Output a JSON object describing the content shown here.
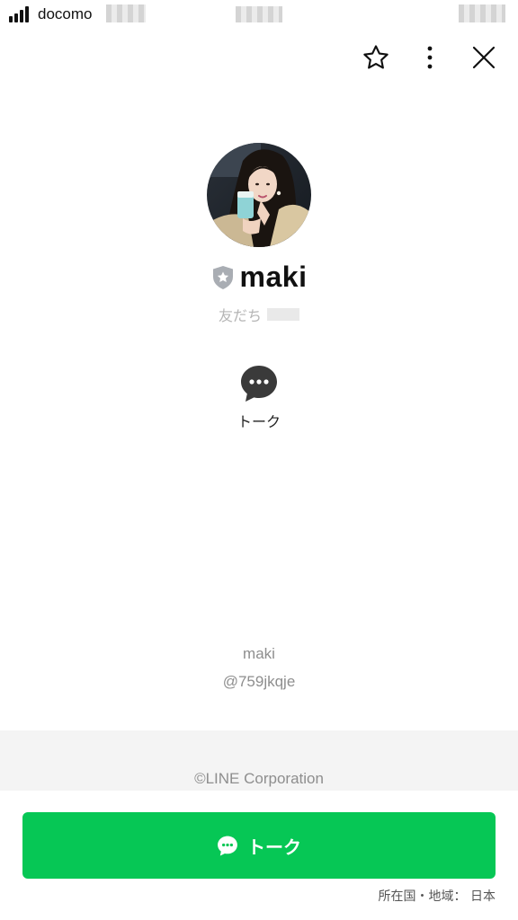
{
  "status_bar": {
    "carrier": "docomo"
  },
  "top_actions": {
    "favorite_icon": "star-outline-icon",
    "more_icon": "vertical-dots-icon",
    "close_icon": "close-x-icon"
  },
  "profile": {
    "display_name": "maki",
    "badge_icon": "shield-star-icon",
    "relation_label": "友だち",
    "user_name": "maki",
    "user_id": "@759jkqje"
  },
  "quick_actions": {
    "talk_label": "トーク",
    "talk_icon": "speech-bubble-dots-icon"
  },
  "footer": {
    "copyright": "©LINE Corporation"
  },
  "cta": {
    "label": "トーク",
    "icon": "speech-bubble-dots-icon",
    "region": "所在国・地域： 日本"
  },
  "colors": {
    "brand_green": "#06c755",
    "muted_text": "#8e8e8e",
    "footer_bg": "#f4f4f4"
  }
}
